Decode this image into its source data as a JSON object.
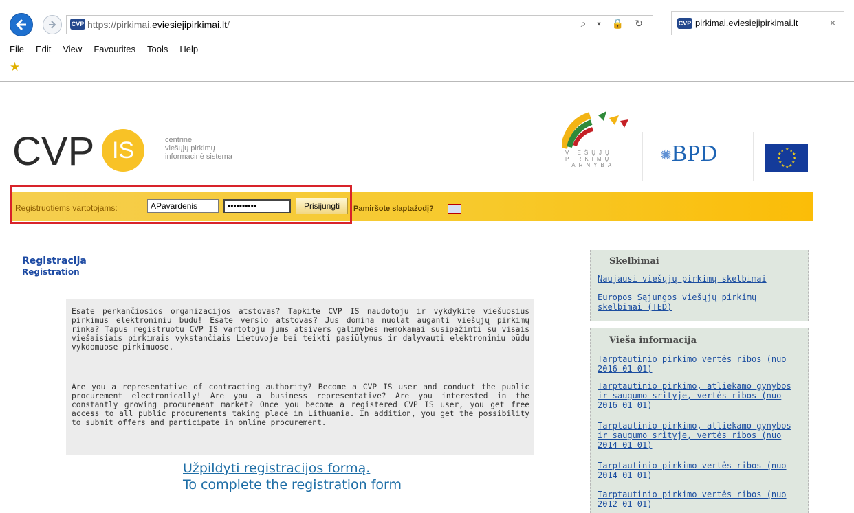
{
  "browser": {
    "url_prefix": "https://pirkimai.",
    "url_domain": "eviesiejipirkimai.lt",
    "url_suffix": "/",
    "favicon_text": "CVP IS",
    "tab_title": "pirkimai.eviesiejipirkimai.lt",
    "tab_close": "×",
    "addr_icons": "⌕ ▾ 🔒 ↻",
    "menu": [
      "File",
      "Edit",
      "View",
      "Favourites",
      "Tools",
      "Help"
    ]
  },
  "header": {
    "logo_text": "CVP",
    "is_text": "IS",
    "tagline": [
      "centrinė",
      "viešųjų pirkimų",
      "informacinė sistema"
    ],
    "vpt_letters": [
      "VIEŠŲJŲ",
      "PIRKIMŲ",
      "TARNYBA"
    ],
    "bpd_text": "BPD"
  },
  "login": {
    "label": "Registruotiems vartotojams:",
    "username": "APavardenis",
    "password_mask": "••••••••••",
    "submit": "Prisijungti",
    "forgot": "Pamiršote slaptažodį?"
  },
  "registration": {
    "title": "Registracija",
    "subtitle": "Registration",
    "lt_text": "Esate perkančiosios organizacijos atstovas? Tapkite CVP IS naudotoju ir vykdykite viešuosius pirkimus elektroniniu būdu! Esate verslo atstovas? Jus domina nuolat auganti viešųjų pirkimų rinka? Tapus registruotu CVP IS vartotoju jums atsivers galimybės nemokamai susipažinti su visais viešaisiais pirkimais vykstančiais Lietuvoje bei teikti pasiūlymus ir dalyvauti elektroniniu būdu vykdomuose pirkimuose.",
    "en_text": "Are you a representative of contracting authority? Become a CVP IS user and conduct the public procurement electronically! Are you a business representative? Are you interested in the constantly growing procurement market? Once you become a registered CVP IS user, you get free access to all public procurements taking place in Lithuania. In addition, you get the possibility to submit offers and participate in online procurement.",
    "link_lt": "Užpildyti registracijos formą.",
    "link_en": "To complete the registration form"
  },
  "sidebar": {
    "skelbimai_title": "Skelbimai",
    "skelbimai_links": [
      "Naujausi viešųjų pirkimų skelbimai",
      "Europos Sąjungos viešųjų pirkimų skelbimai (TED)"
    ],
    "info_title": "Vieša informacija",
    "info_links": [
      "Tarptautinio pirkimo vertės ribos (nuo 2016-01-01)",
      "Tarptautinio pirkimo, atliekamo gynybos ir saugumo srityje, vertės ribos (nuo 2016 01 01)",
      "Tarptautinio pirkimo, atliekamo gynybos ir saugumo srityje, vertės ribos (nuo 2014 01 01)",
      "Tarptautinio pirkimo vertės ribos (nuo 2014 01 01)",
      "Tarptautinio pirkimo vertės ribos (nuo 2012 01 01)"
    ]
  }
}
